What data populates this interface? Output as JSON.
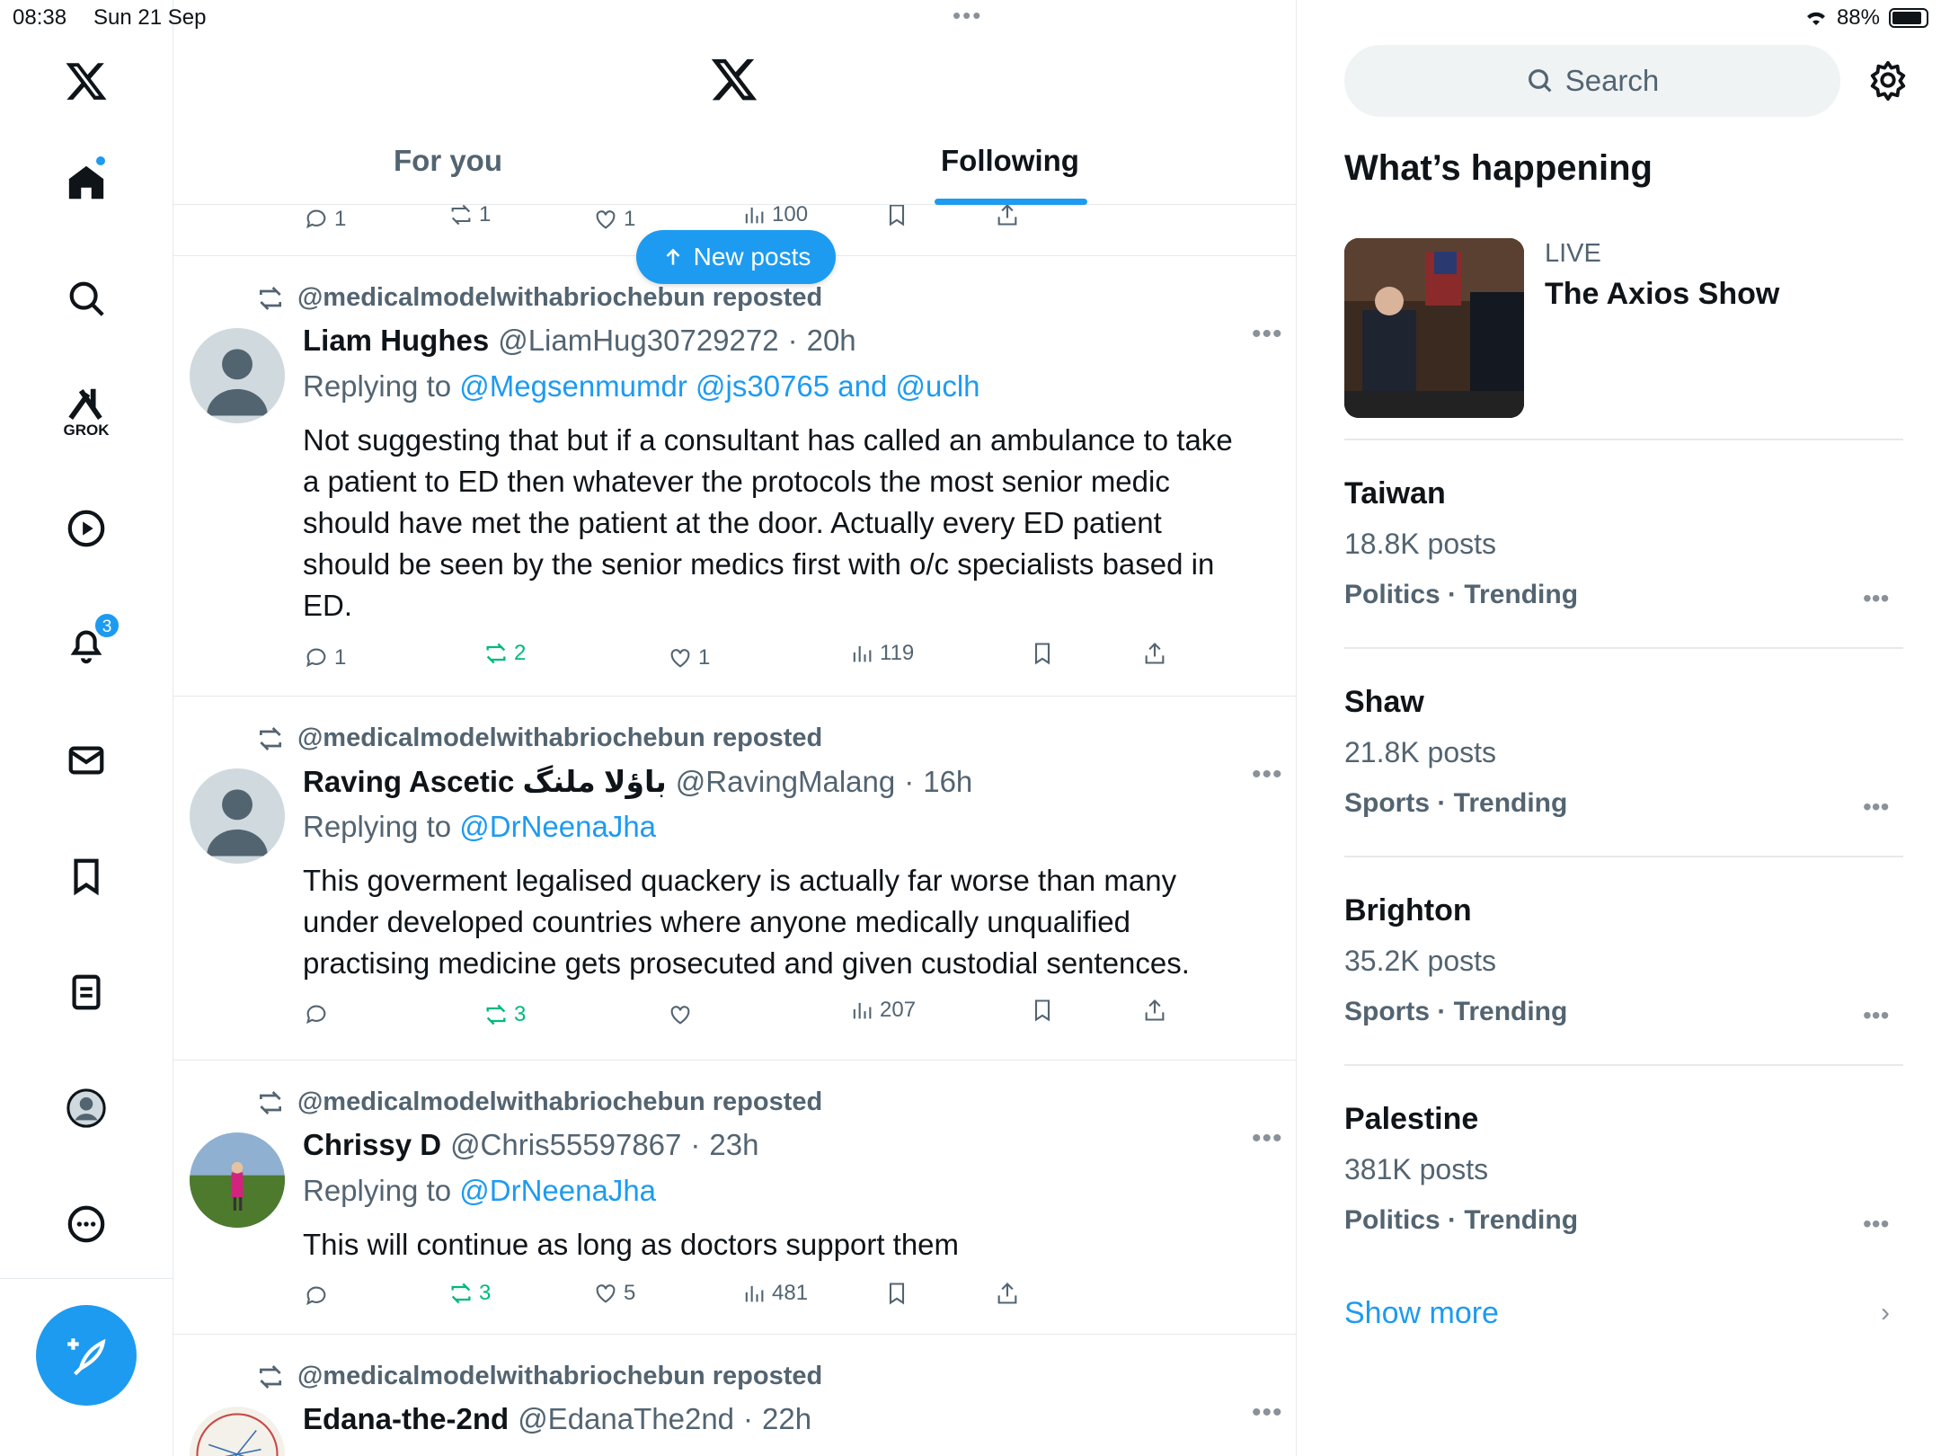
{
  "status_bar": {
    "time": "08:38",
    "date": "Sun 21 Sep",
    "battery": "88%",
    "battery_level": 0.88
  },
  "nav": {
    "notifications_badge": "3",
    "grok_label": "GROK"
  },
  "timeline": {
    "tabs": [
      {
        "label": "For you",
        "active": false
      },
      {
        "label": "Following",
        "active": true
      }
    ],
    "new_posts_label": "New posts",
    "previous_post_actions": {
      "replies": "1",
      "reposts": "1",
      "likes": "1",
      "views": "100"
    },
    "posts": [
      {
        "reposted_by": "@medicalmodelwithabriochebun reposted",
        "name": "Liam Hughes",
        "handle": "@LiamHug30729272",
        "dot": "·",
        "time": "20h",
        "replying_prefix": "Replying to ",
        "replying_to": "@Megsenmumdr @js30765 and @uclh",
        "text": "Not suggesting that but if a consultant has called an ambulance to take a patient to ED then whatever the protocols the most senior medic should have met the patient at the door. Actually every ED patient should be seen by the senior medics first with o/c specialists based in ED.",
        "replies": "1",
        "reposts": "2",
        "likes": "1",
        "views": "119"
      },
      {
        "reposted_by": "@medicalmodelwithabriochebun reposted",
        "name": "Raving Ascetic باؤلا ملنگ",
        "handle": "@RavingMalang",
        "dot": "·",
        "time": "16h",
        "replying_prefix": "Replying to ",
        "replying_to": "@DrNeenaJha",
        "text": "This goverment legalised quackery is actually far worse than many under developed countries where anyone medically unqualified practising medicine gets prosecuted and given custodial sentences.",
        "replies": "",
        "reposts": "3",
        "likes": "",
        "views": "207"
      },
      {
        "reposted_by": "@medicalmodelwithabriochebun reposted",
        "name": "Chrissy D",
        "handle": "@Chris55597867",
        "dot": "·",
        "time": "23h",
        "replying_prefix": "Replying to ",
        "replying_to": "@DrNeenaJha",
        "text": "This will continue as long as doctors support them",
        "replies": "",
        "reposts": "3",
        "likes": "5",
        "views": "481"
      },
      {
        "reposted_by": "@medicalmodelwithabriochebun reposted",
        "name": "Edana-the-2nd",
        "handle": "@EdanaThe2nd",
        "dot": "·",
        "time": "22h"
      }
    ]
  },
  "right": {
    "search_placeholder": "Search",
    "whats_happening": "What’s happening",
    "live": {
      "label": "LIVE",
      "title": "The Axios Show"
    },
    "trends": [
      {
        "title": "Taiwan",
        "count": "18.8K posts",
        "category": "Politics · Trending"
      },
      {
        "title": "Shaw",
        "count": "21.8K posts",
        "category": "Sports · Trending"
      },
      {
        "title": "Brighton",
        "count": "35.2K posts",
        "category": "Sports · Trending"
      },
      {
        "title": "Palestine",
        "count": "381K posts",
        "category": "Politics · Trending"
      }
    ],
    "show_more": "Show more"
  },
  "colors": {
    "accent": "#1d9bf0",
    "repost_green": "#00ba7c",
    "secondary_text": "#536471"
  }
}
